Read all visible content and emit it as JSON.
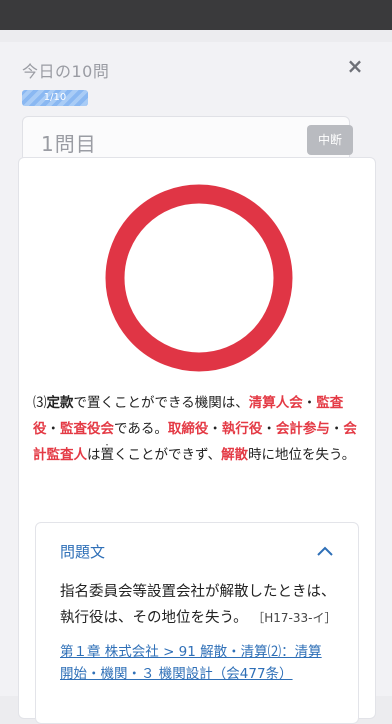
{
  "header": {
    "title": "今日の10問",
    "close_icon": "×",
    "progress_label": "1/10"
  },
  "question_bar": {
    "number_label": "1問目",
    "pause_label": "中断"
  },
  "result": {
    "icon": "correct-circle-icon",
    "color": "#e03545"
  },
  "explanation": {
    "marker": "⑶",
    "parts": [
      {
        "t": "定款",
        "s": "bold"
      },
      {
        "t": "で置くことができる機関は、",
        "s": "normal"
      },
      {
        "t": "清算人会",
        "s": "red"
      },
      {
        "t": "・",
        "s": "normal"
      },
      {
        "t": "監査役",
        "s": "red"
      },
      {
        "t": "・",
        "s": "normal"
      },
      {
        "t": "監査役会",
        "s": "red"
      },
      {
        "t": "である。",
        "s": "normal"
      },
      {
        "t": "取締役",
        "s": "red"
      },
      {
        "t": "・",
        "s": "normal"
      },
      {
        "t": "執行役",
        "s": "red"
      },
      {
        "t": "・",
        "s": "normal"
      },
      {
        "t": "会計参与",
        "s": "red"
      },
      {
        "t": "・",
        "s": "normal"
      },
      {
        "t": "会計監査人",
        "s": "red"
      },
      {
        "t": "は",
        "s": "normal"
      },
      {
        "t": "置く",
        "s": "dotted"
      },
      {
        "t": "ことができず、",
        "s": "normal"
      },
      {
        "t": "解散",
        "s": "red"
      },
      {
        "t": "時に地位を失う。",
        "s": "normal"
      }
    ]
  },
  "question_panel": {
    "heading": "問題文",
    "text": "指名委員会等設置会社が解散したときは、執行役は、その地位を失う。",
    "ref": "［H17-33-イ］",
    "link_line1": "第１章 株式会社 > 91 解散・清算⑵：清算",
    "link_line2": "開始・機関・３ 機関設計（会477条）"
  }
}
